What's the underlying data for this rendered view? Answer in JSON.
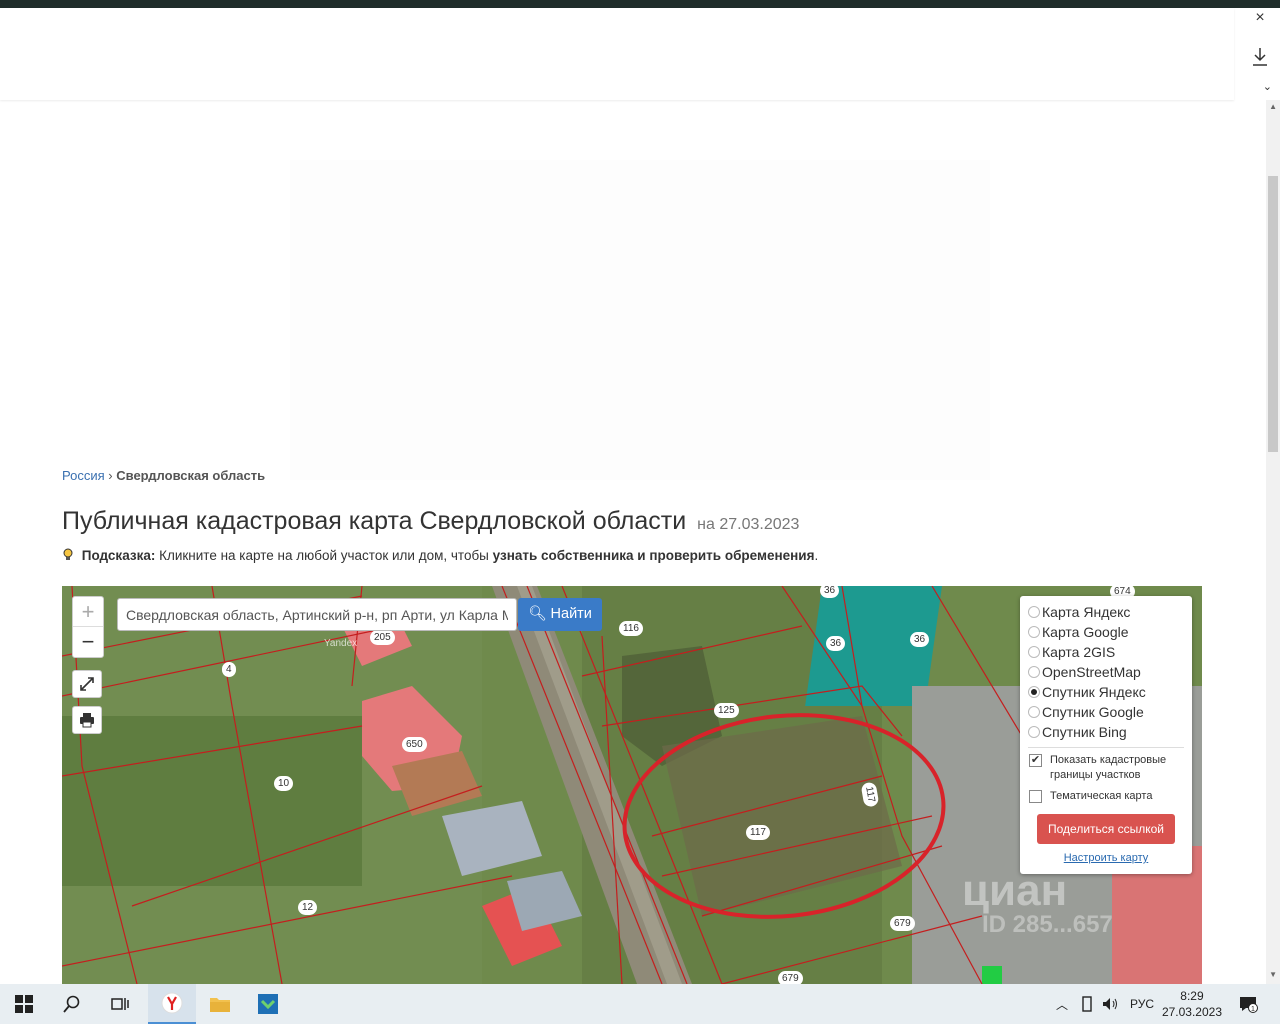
{
  "window": {
    "close_icon": "×"
  },
  "breadcrumb": {
    "item1": "Россия",
    "sep": "›",
    "item2": "Свердловская область"
  },
  "page": {
    "title": "Публичная кадастровая карта Свердловской области",
    "date": "на 27.03.2023",
    "hint_label": "Подсказка:",
    "hint_text": "Кликните на карте на любой участок или дом, чтобы",
    "hint_bold": "узнать собственника и проверить обременения",
    "hint_end": "."
  },
  "map": {
    "zoom_in": "+",
    "zoom_out": "−",
    "search_value": "Свердловская область, Артинский р-н, рп Арти, ул Карла Маркса",
    "find_label": "Найти",
    "attribution": "Yandex",
    "layers": [
      {
        "label": "Карта Яндекс",
        "selected": false
      },
      {
        "label": "Карта Google",
        "selected": false
      },
      {
        "label": "Карта 2GIS",
        "selected": false
      },
      {
        "label": "OpenStreetMap",
        "selected": false
      },
      {
        "label": "Спутник Яндекс",
        "selected": true
      },
      {
        "label": "Спутник Google",
        "selected": false
      },
      {
        "label": "Спутник Bing",
        "selected": false
      }
    ],
    "show_cadastral_label": "Показать кадастровые границы участков",
    "show_cadastral_checked": true,
    "thematic_label": "Тематическая карта",
    "thematic_checked": false,
    "share_label": "Поделиться ссылкой",
    "configure_label": "Настроить карту",
    "parcels": [
      "36",
      "674",
      "36",
      "36",
      "116",
      "205",
      "4",
      "125",
      "650",
      "10",
      "117",
      "117",
      "12",
      "679",
      "679"
    ],
    "watermark": "циан",
    "watermark_id": "ID 285...657"
  },
  "taskbar": {
    "language": "РУС",
    "time": "8:29",
    "date": "27.03.2023",
    "notifications": "1"
  },
  "colors": {
    "find_button": "#3a7bc8",
    "share_button": "#d9534f",
    "highlight_ellipse": "#d8232a",
    "parcel_lines": "#c41e1e"
  }
}
